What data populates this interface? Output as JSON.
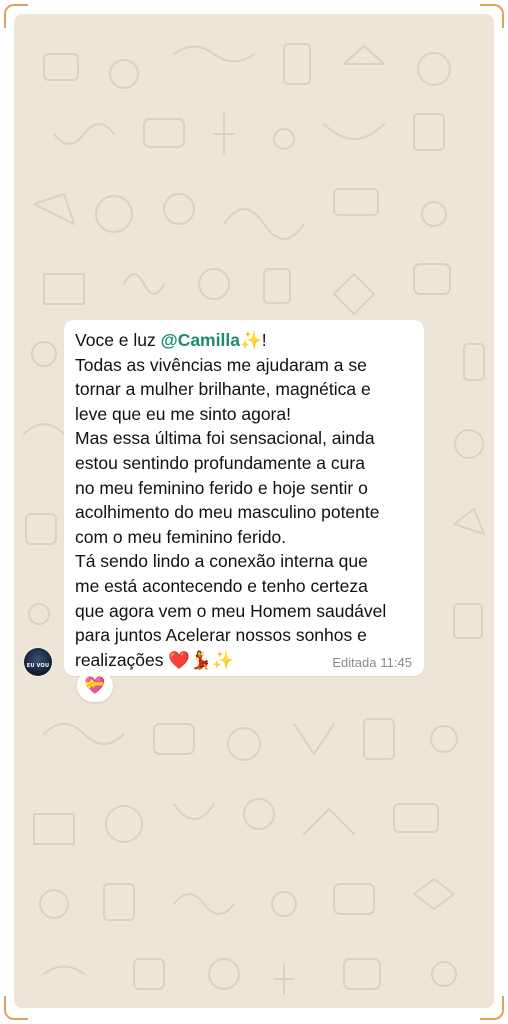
{
  "chat": {
    "sender_avatar": {
      "icon": "avatar-icon",
      "text": "EU VOU"
    },
    "message": {
      "prefix": "Voce e luz ",
      "mention": "@Camilla",
      "mention_emoji": "✨",
      "after_mention": "!",
      "body": "Todas as vivências me ajudaram a se\ntornar a mulher brilhante, magnética e\nleve que eu me sinto agora!\nMas essa última foi sensacional, ainda\nestou sentindo profundamente a cura\nno meu feminino ferido e hoje sentir o\nacolhimento do meu masculino potente\ncom o meu feminino ferido.\nTá sendo lindo a conexão interna que\nme está acontecendo e tenho certeza\nque agora vem o meu Homem saudável\npara juntos Acelerar nossos sonhos e\nrealizações",
      "end_emojis": "❤️💃✨",
      "edited_label": "Editada",
      "time": "11:45"
    },
    "reaction": {
      "emoji": "💝"
    },
    "colors": {
      "background": "#ede5d8",
      "bubble": "#ffffff",
      "mention": "#1f8a70",
      "meta_text": "#8a8a8a",
      "frame_corner": "#e0a25a"
    }
  }
}
